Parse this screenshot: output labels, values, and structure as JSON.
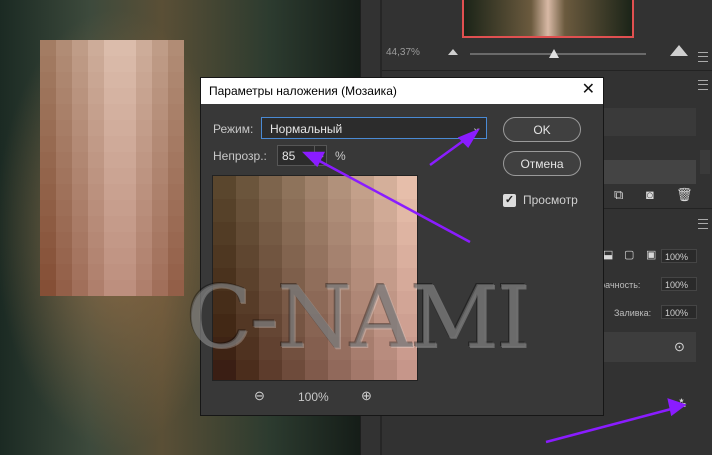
{
  "navigator": {
    "zoom": "44,37%"
  },
  "dialog": {
    "title": "Параметры наложения (Мозаика)",
    "close": "✕",
    "mode_label": "Режим:",
    "mode_value": "Нормальный",
    "opacity_label": "Непрозр.:",
    "opacity_value": "85",
    "opacity_unit": "%",
    "ok": "OK",
    "cancel": "Отмена",
    "preview_label": "Просмотр",
    "preview_checked": true,
    "preview_zoom": "100%"
  },
  "layers_panel": {
    "opacity_label": "зрачность:",
    "opacity_value": "100%",
    "fill_label": "Заливка:",
    "fill_value": "100%",
    "top_value": "100%"
  },
  "watermark": "C-NAMI",
  "colors": {
    "annotation_arrow": "#8a1cff",
    "selection_border": "#4a8ad4",
    "dialog_bg": "#383838"
  }
}
